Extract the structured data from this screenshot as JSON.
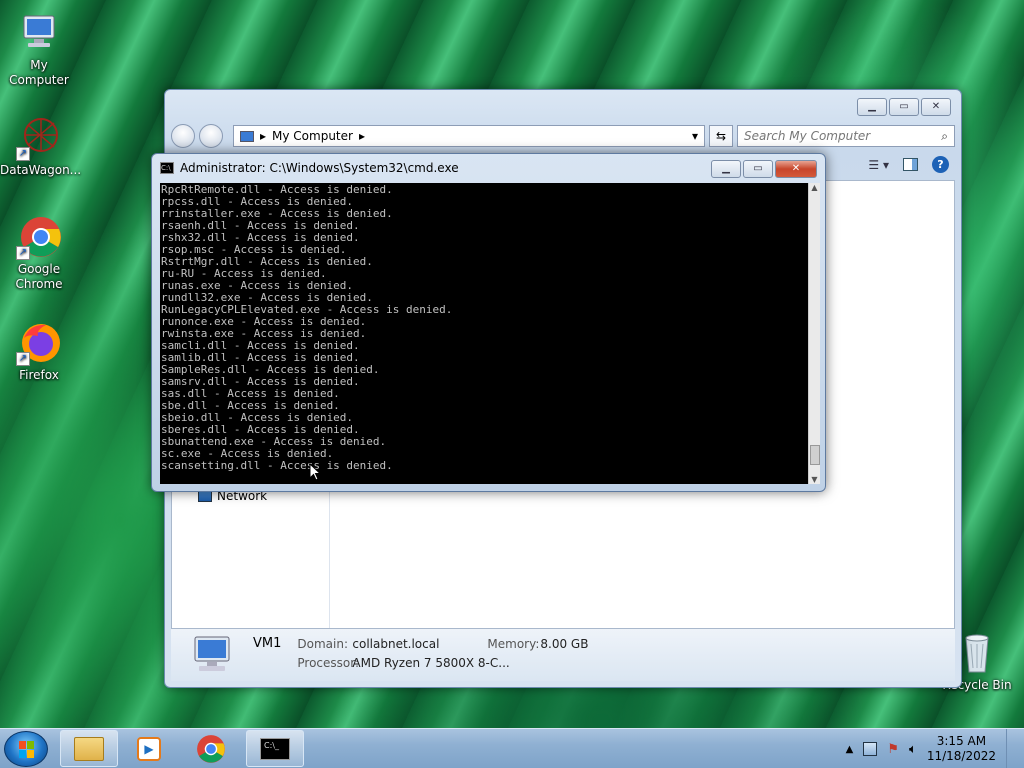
{
  "desktop": {
    "icons": [
      {
        "label": "My Computer"
      },
      {
        "label": "DataWagon..."
      },
      {
        "label": "Google Chrome"
      },
      {
        "label": "Firefox"
      },
      {
        "label": "Recycle Bin"
      }
    ]
  },
  "explorer": {
    "address": "My Computer",
    "search_placeholder": "Search My Computer",
    "nav_network": "Network",
    "details": {
      "name": "VM1",
      "domain_label": "Domain:",
      "domain_value": "collabnet.local",
      "memory_label": "Memory:",
      "memory_value": "8.00 GB",
      "processor_label": "Processor:",
      "processor_value": "AMD Ryzen 7 5800X 8-C..."
    }
  },
  "cmd": {
    "title": "Administrator:  C:\\Windows\\System32\\cmd.exe",
    "lines": [
      "RpcRtRemote.dll - Access is denied.",
      "rpcss.dll - Access is denied.",
      "rrinstaller.exe - Access is denied.",
      "rsaenh.dll - Access is denied.",
      "rshx32.dll - Access is denied.",
      "rsop.msc - Access is denied.",
      "RstrtMgr.dll - Access is denied.",
      "ru-RU - Access is denied.",
      "runas.exe - Access is denied.",
      "rundll32.exe - Access is denied.",
      "RunLegacyCPLElevated.exe - Access is denied.",
      "runonce.exe - Access is denied.",
      "rwinsta.exe - Access is denied.",
      "samcli.dll - Access is denied.",
      "samlib.dll - Access is denied.",
      "SampleRes.dll - Access is denied.",
      "samsrv.dll - Access is denied.",
      "sas.dll - Access is denied.",
      "sbe.dll - Access is denied.",
      "sbeio.dll - Access is denied.",
      "sberes.dll - Access is denied.",
      "sbunattend.exe - Access is denied.",
      "sc.exe - Access is denied.",
      "scansetting.dll - Access is denied."
    ]
  },
  "taskbar": {
    "time": "3:15 AM",
    "date": "11/18/2022"
  }
}
